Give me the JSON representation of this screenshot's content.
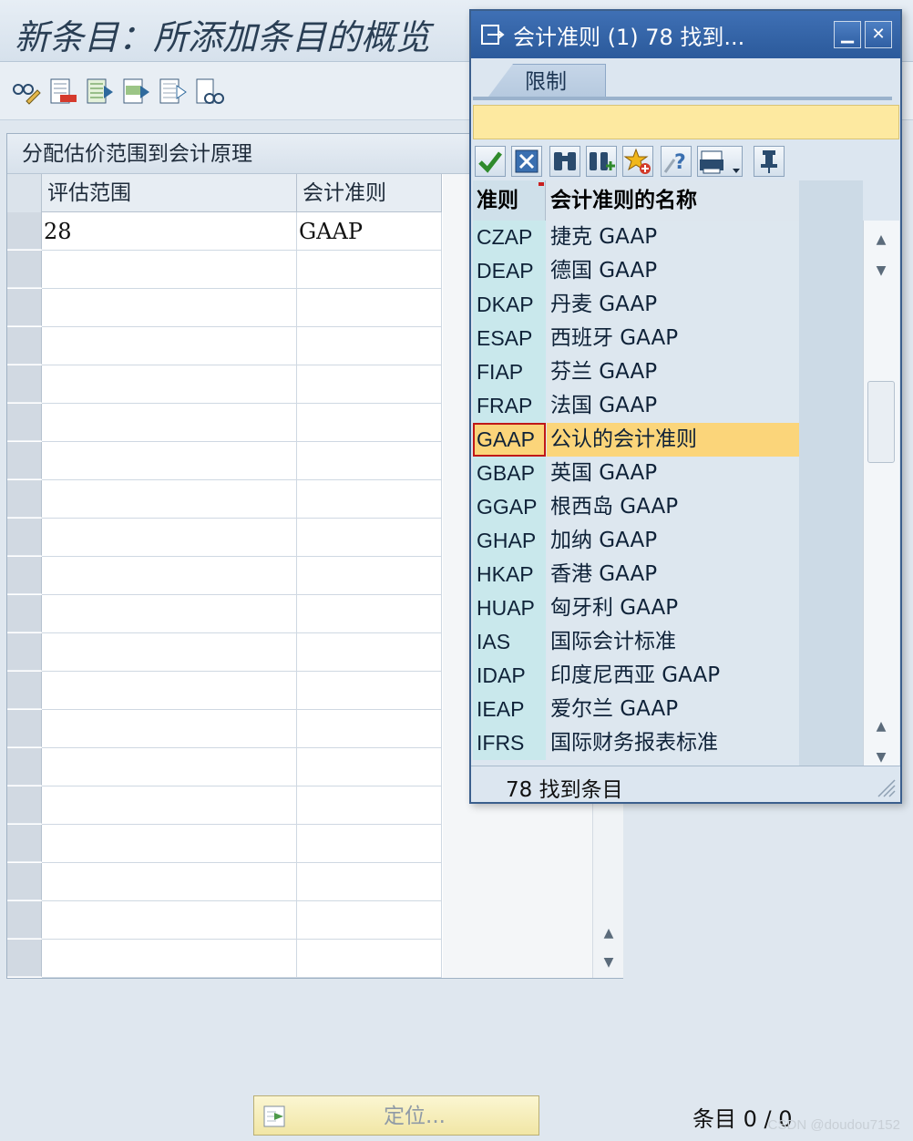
{
  "screen": {
    "title": "新条目：所添加条目的概览",
    "panel_title": "分配估价范围到会计原理",
    "columns": [
      "评估范围",
      "会计准则"
    ],
    "rows": [
      [
        "28",
        "GAAP"
      ]
    ],
    "locate_button": "定位...",
    "entry_count": "条目 0 / 0",
    "watermark": "CSDN @doudou7152"
  },
  "toolbar_icons": [
    "glasses-pencil-icon",
    "delete-row-icon",
    "select-all-icon",
    "select-block-icon",
    "deselect-all-icon",
    "print-preview-icon"
  ],
  "popup": {
    "title": "会计准则 (1)   78 找到...",
    "minimize": "▁",
    "close": "✕",
    "tab": "限制",
    "toolbar_icons": [
      "checkmark-icon",
      "cancel-icon",
      "binoculars-icon",
      "binoculars-plus-icon",
      "star-add-icon",
      "help-icon",
      "print-icon",
      "pin-icon"
    ],
    "col_key": "准则",
    "col_name": "会计准则的名称",
    "items": [
      {
        "code": "CZAP",
        "name": "捷克 GAAP"
      },
      {
        "code": "DEAP",
        "name": "德国 GAAP"
      },
      {
        "code": "DKAP",
        "name": "丹麦 GAAP"
      },
      {
        "code": "ESAP",
        "name": "西班牙 GAAP"
      },
      {
        "code": "FIAP",
        "name": "芬兰 GAAP"
      },
      {
        "code": "FRAP",
        "name": "法国 GAAP"
      },
      {
        "code": "GAAP",
        "name": "公认的会计准则"
      },
      {
        "code": "GBAP",
        "name": "英国 GAAP"
      },
      {
        "code": "GGAP",
        "name": "根西岛 GAAP"
      },
      {
        "code": "GHAP",
        "name": "加纳 GAAP"
      },
      {
        "code": "HKAP",
        "name": "香港 GAAP"
      },
      {
        "code": "HUAP",
        "name": "匈牙利 GAAP"
      },
      {
        "code": "IAS",
        "name": "国际会计标准"
      },
      {
        "code": "IDAP",
        "name": "印度尼西亚 GAAP"
      },
      {
        "code": "IEAP",
        "name": "爱尔兰 GAAP"
      },
      {
        "code": "IFRS",
        "name": "国际财务报表标准"
      }
    ],
    "selected_code": "GAAP",
    "status": "78 找到条目"
  }
}
